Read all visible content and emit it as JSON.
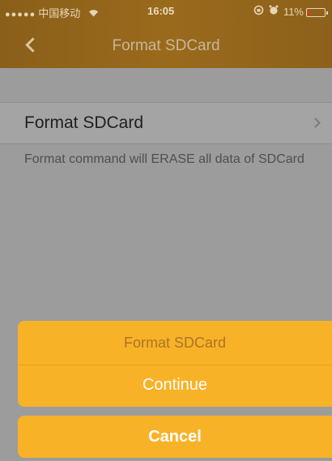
{
  "status_bar": {
    "signal": "●●●●●",
    "carrier": "中国移动",
    "wifi_icon": "wifi-icon",
    "time": "16:05",
    "lock_icon": "rotation-lock-icon",
    "alarm_icon": "alarm-icon",
    "battery_text": "11%",
    "battery_level": 0.11,
    "battery_color": "#e8332a"
  },
  "nav": {
    "back_icon": "chevron-left-icon",
    "title": "Format SDCard"
  },
  "settings_row": {
    "label": "Format SDCard",
    "chevron_icon": "chevron-right-icon"
  },
  "description": "Format command will ERASE all data of SDCard",
  "action_sheet": {
    "title": "Format SDCard",
    "continue_label": "Continue",
    "cancel_label": "Cancel",
    "accent_color": "#f8b227"
  }
}
